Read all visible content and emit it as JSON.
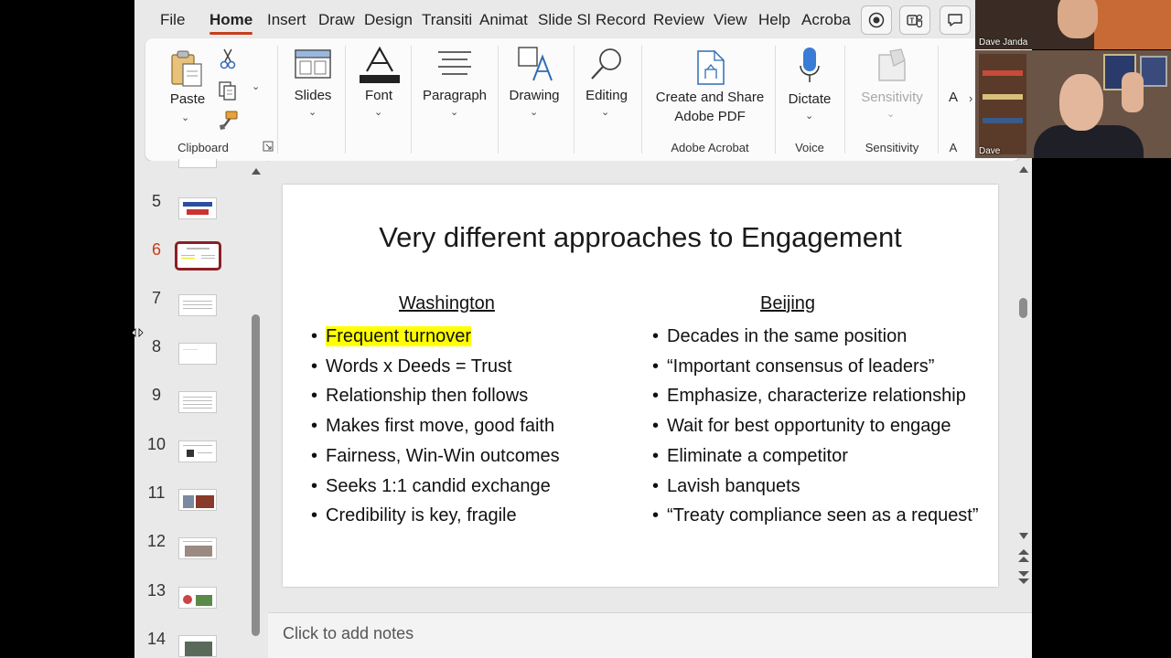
{
  "menubar": {
    "tabs": [
      {
        "label": "File",
        "active": false
      },
      {
        "label": "Home",
        "active": true
      },
      {
        "label": "Insert",
        "active": false
      },
      {
        "label": "Draw",
        "active": false
      },
      {
        "label": "Design",
        "active": false
      },
      {
        "label": "Transiti",
        "active": false
      },
      {
        "label": "Animat",
        "active": false
      },
      {
        "label": "Slide Sl",
        "active": false
      },
      {
        "label": "Record",
        "active": false
      },
      {
        "label": "Review",
        "active": false
      },
      {
        "label": "View",
        "active": false
      },
      {
        "label": "Help",
        "active": false
      },
      {
        "label": "Acroba",
        "active": false
      }
    ]
  },
  "ribbon": {
    "paste_label": "Paste",
    "clipboard_group": "Clipboard",
    "slides_label": "Slides",
    "font_label": "Font",
    "paragraph_label": "Paragraph",
    "drawing_label": "Drawing",
    "editing_label": "Editing",
    "create_share_label_1": "Create and Share",
    "create_share_label_2": "Adobe PDF",
    "adobe_group": "Adobe Acrobat",
    "dictate_label": "Dictate",
    "voice_group": "Voice",
    "sensitivity_label": "Sensitivity",
    "sensitivity_group": "Sensitivity",
    "cut_label": "A",
    "cut_group": "A"
  },
  "thumbnails": {
    "numbers": [
      "5",
      "6",
      "7",
      "8",
      "9",
      "10",
      "11",
      "12",
      "13",
      "14"
    ],
    "current": "6"
  },
  "slide": {
    "title": "Very different approaches to Engagement",
    "left_heading": "Washington",
    "right_heading": "Beijing",
    "left_items": [
      "Frequent turnover",
      "Words x Deeds = Trust",
      "Relationship then follows",
      "Makes first move, good faith",
      "Fairness, Win-Win outcomes",
      "Seeks 1:1 candid exchange",
      "Credibility is key, fragile"
    ],
    "right_items": [
      "Decades in the same position",
      "“Important consensus of leaders”",
      "Emphasize, characterize relationship",
      "Wait for best opportunity to engage",
      "Eliminate a competitor",
      "Lavish banquets",
      "“Treaty compliance seen as a request”"
    ],
    "highlight_color": "#ffff00"
  },
  "notes": {
    "placeholder": "Click to add notes"
  },
  "participants": [
    {
      "name": "Dave Janda"
    },
    {
      "name": "Dave"
    }
  ],
  "colors": {
    "accent": "#c43e1c",
    "current_thumb_border": "#8c1f24"
  }
}
